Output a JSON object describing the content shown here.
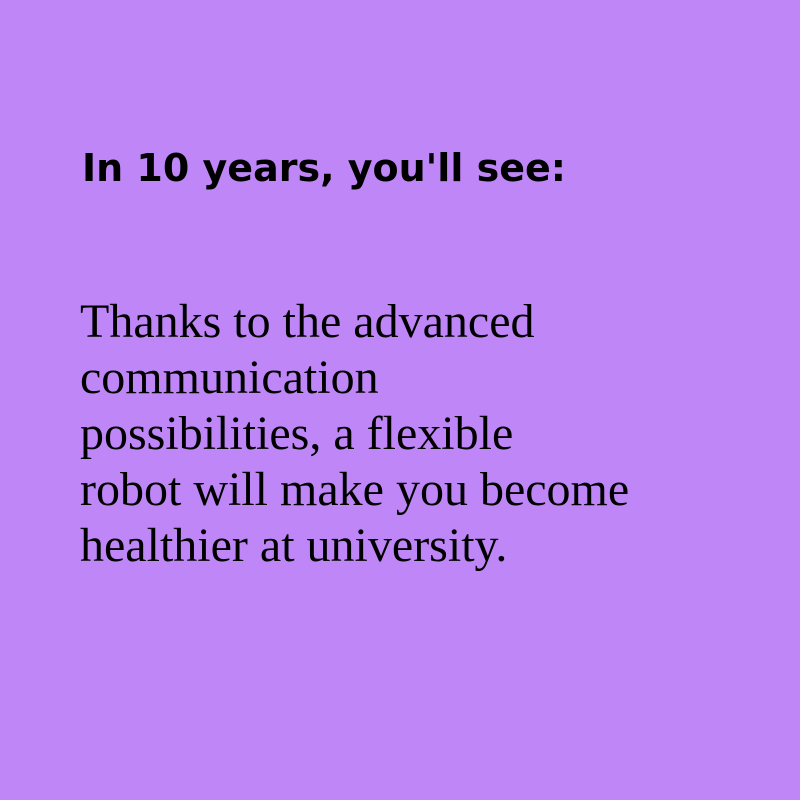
{
  "card": {
    "background_color": "#bf86f7",
    "text_color": "#000000",
    "heading": "In 10 years, you'll see:",
    "body_lines": [
      "Thanks to the advanced",
      "communication",
      "possibilities, a flexible",
      "robot will make you become",
      "healthier at university."
    ]
  }
}
